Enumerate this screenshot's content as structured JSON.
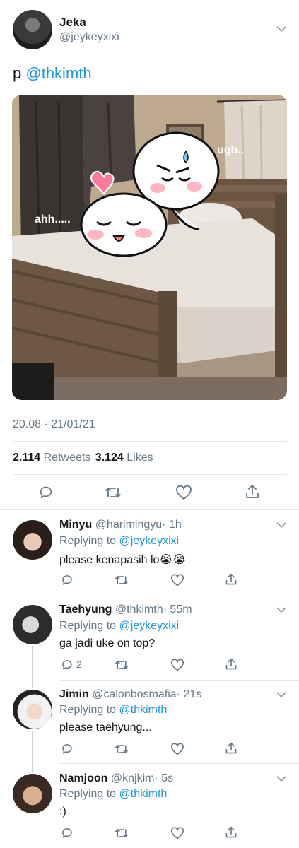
{
  "tweet": {
    "author_name": "Jeka",
    "author_handle": "@jeykeyxixi",
    "text_prefix": "p",
    "mention": "@thkimth",
    "image_text_left": "ahh.....",
    "image_text_right": "ugh..",
    "timestamp": "20.08 · 21/01/21",
    "retweets_count": "2.114",
    "retweets_label": "Retweets",
    "likes_count": "3.124",
    "likes_label": "Likes"
  },
  "replies": [
    {
      "name": "Minyu",
      "handle": "@harimingyu",
      "time": "· 1h",
      "replying_label": "Replying to",
      "replying_to": "@jeykeyxixi",
      "text": "please kenapasih lo😭😭",
      "reply_count": ""
    },
    {
      "name": "Taehyung",
      "handle": "@thkimth",
      "time": "· 55m",
      "replying_label": "Replying to",
      "replying_to": "@jeykeyxixi",
      "text": "ga jadi uke on top?",
      "reply_count": "2"
    },
    {
      "name": "Jimin",
      "handle": "@calonbosmafia",
      "time": "· 21s",
      "replying_label": "Replying to",
      "replying_to": "@thkimth",
      "text": "please taehyung...",
      "reply_count": ""
    },
    {
      "name": "Namjoon",
      "handle": "@knjkim",
      "time": "· 5s",
      "replying_label": "Replying to",
      "replying_to": "@thkimth",
      "text": ":)",
      "reply_count": ""
    }
  ],
  "icons": [
    "reply-icon",
    "retweet-icon",
    "like-icon",
    "share-icon",
    "chevron-down-icon",
    "heart-sticker-icon"
  ],
  "colors": {
    "link": "#1b95e0",
    "muted": "#657786",
    "divider": "#e1e8ed",
    "icon": "#657786"
  }
}
